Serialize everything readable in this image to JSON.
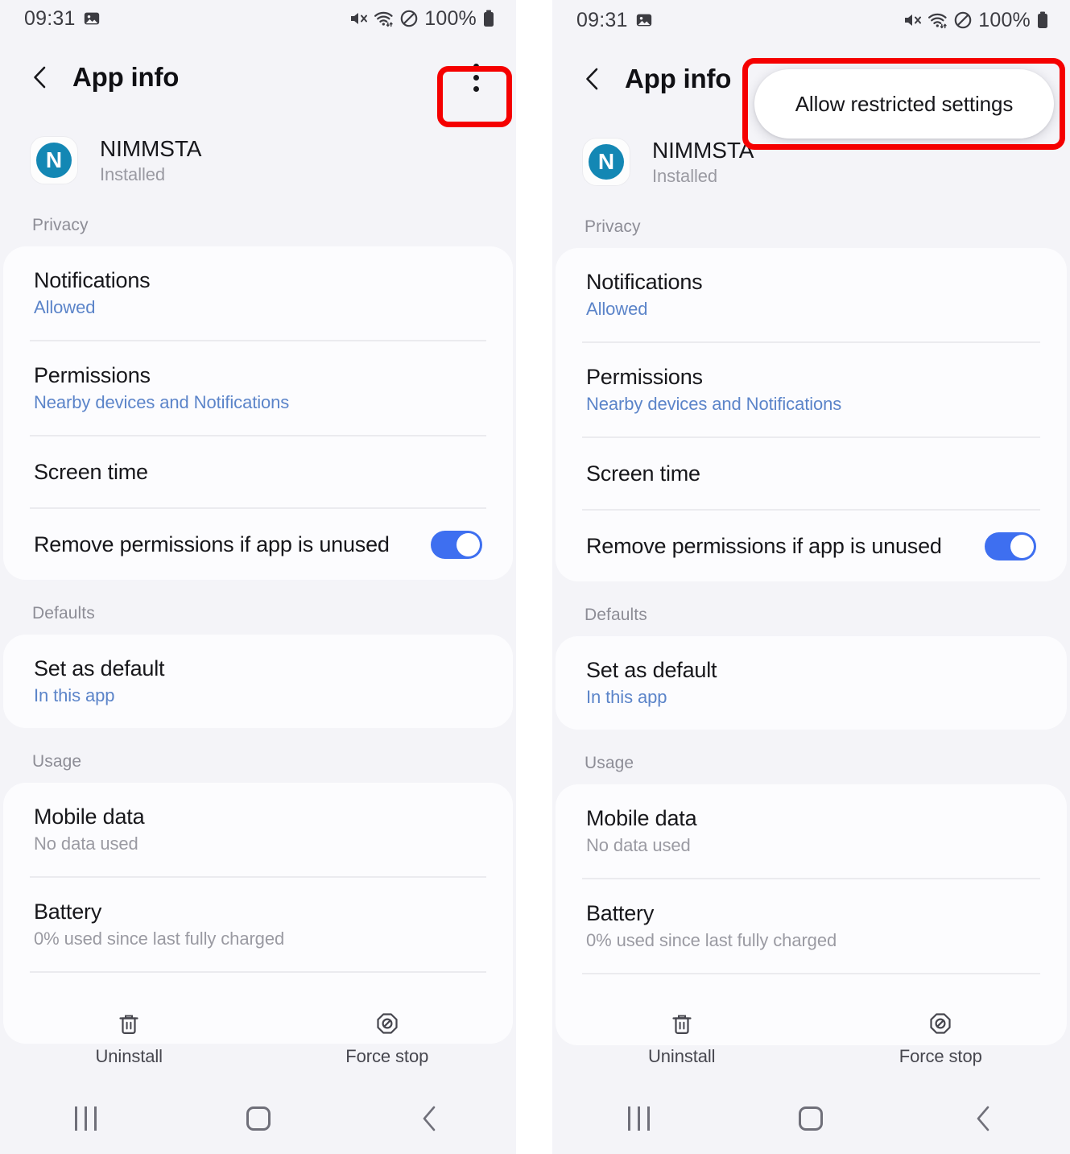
{
  "statusbar": {
    "time": "09:31",
    "battery_text": "100%",
    "icons": [
      "image-icon",
      "mute-icon",
      "wifi-icon",
      "do-not-disturb-icon",
      "battery-icon"
    ]
  },
  "appbar": {
    "title": "App info",
    "back_icon": "back-chevron-icon",
    "overflow_icon": "overflow-menu-icon"
  },
  "popup": {
    "item_label": "Allow restricted settings"
  },
  "app": {
    "icon_letter": "N",
    "name": "NIMMSTA",
    "status": "Installed"
  },
  "sections": [
    {
      "title": "Privacy",
      "rows": [
        {
          "title": "Notifications",
          "sub": "Allowed",
          "sub_style": "blue",
          "toggle": null
        },
        {
          "title": "Permissions",
          "sub": "Nearby devices and Notifications",
          "sub_style": "blue",
          "toggle": null
        },
        {
          "title": "Screen time",
          "sub": null,
          "sub_style": null,
          "toggle": null
        },
        {
          "title": "Remove permissions if app is unused",
          "sub": null,
          "sub_style": null,
          "toggle": "on"
        }
      ]
    },
    {
      "title": "Defaults",
      "rows": [
        {
          "title": "Set as default",
          "sub": "In this app",
          "sub_style": "blue",
          "toggle": null
        }
      ]
    },
    {
      "title": "Usage",
      "rows": [
        {
          "title": "Mobile data",
          "sub": "No data used",
          "sub_style": "grey",
          "toggle": null
        },
        {
          "title": "Battery",
          "sub": "0% used since last fully charged",
          "sub_style": "grey",
          "toggle": null
        }
      ]
    }
  ],
  "bottom_actions": [
    {
      "label": "Uninstall",
      "icon": "trash-icon"
    },
    {
      "label": "Force stop",
      "icon": "force-stop-icon"
    }
  ],
  "navbar": {
    "recents_icon": "recents-icon",
    "home_icon": "home-icon",
    "back_icon": "nav-back-icon"
  },
  "colors": {
    "accent_blue": "#3e6ff0",
    "link_blue": "#5b84c9",
    "highlight_red": "#f50000",
    "app_icon_teal": "#1387b4",
    "page_bg": "#f4f4f8",
    "card_bg": "#fcfcfe"
  }
}
